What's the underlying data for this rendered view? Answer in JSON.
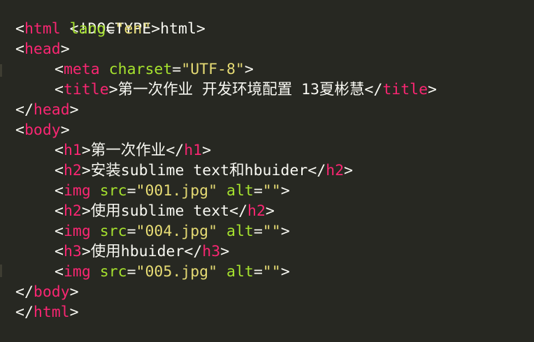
{
  "editor": {
    "colors": {
      "background": "#272822",
      "tag": "#f92672",
      "attribute": "#a6e22e",
      "string": "#e6db74",
      "text": "#f8f8f2"
    },
    "lines": [
      {
        "doctype": "<!DOCTYPE html>"
      },
      {
        "tag": "html",
        "attr": "lang",
        "value": "\"en\""
      },
      {
        "tag": "head"
      },
      {
        "tag": "meta",
        "attr": "charset",
        "value": "\"UTF-8\""
      },
      {
        "tag": "title",
        "text": "第一次作业 开发环境配置 13夏彬慧"
      },
      {
        "tag": "head"
      },
      {
        "tag": "body"
      },
      {
        "tag": "h1",
        "text": "第一次作业"
      },
      {
        "tag": "h2",
        "text": "安装sublime text和hbuider"
      },
      {
        "tag": "img",
        "attr1": "src",
        "value1": "\"001.jpg\"",
        "attr2": "alt",
        "value2": "\"\""
      },
      {
        "tag": "h2",
        "text": "使用sublime text"
      },
      {
        "tag": "img",
        "attr1": "src",
        "value1": "\"004.jpg\"",
        "attr2": "alt",
        "value2": "\"\""
      },
      {
        "tag": "h3",
        "text": "使用hbuider"
      },
      {
        "tag": "img",
        "attr1": "src",
        "value1": "\"005.jpg\"",
        "attr2": "alt",
        "value2": "\"\""
      },
      {
        "tag": "body"
      },
      {
        "tag": "html"
      }
    ]
  }
}
